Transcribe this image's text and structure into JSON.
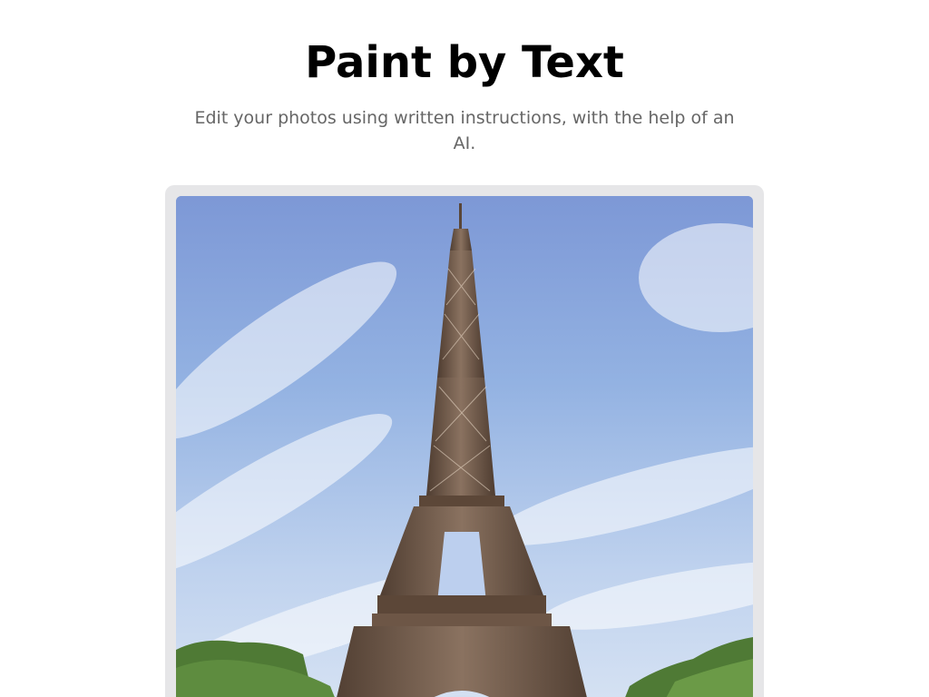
{
  "header": {
    "title": "Paint by Text",
    "subtitle": "Edit your photos using written instructions, with the help of an AI."
  },
  "main": {
    "image": {
      "subject": "eiffel-tower-photo"
    }
  },
  "colors": {
    "title": "#000000",
    "subtitle": "#666666",
    "card_bg": "#e6e6e8",
    "sky": "#8fb0e0",
    "tower": "#6b5545",
    "trees": "#4f7a35"
  }
}
